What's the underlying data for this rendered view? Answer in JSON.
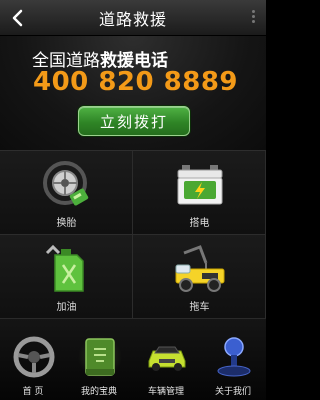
{
  "header": {
    "title": "道路救援",
    "back_icon": "back-arrow-icon",
    "menu_icon": "more-vertical-icon"
  },
  "hotline": {
    "label_prefix": "全国道路",
    "label_bold": "救援电话",
    "number": "400 820 8889",
    "call_button": "立刻拨打",
    "number_color": "#f39a18",
    "button_color": "#2f8526"
  },
  "services": [
    {
      "label": "换胎",
      "icon": "tire-icon"
    },
    {
      "label": "搭电",
      "icon": "battery-icon"
    },
    {
      "label": "加油",
      "icon": "fuel-can-icon"
    },
    {
      "label": "拖车",
      "icon": "tow-truck-icon"
    }
  ],
  "tabs": [
    {
      "label": "首 页",
      "icon": "steering-wheel-icon"
    },
    {
      "label": "我的宝典",
      "icon": "book-icon"
    },
    {
      "label": "车辆管理",
      "icon": "car-icon"
    },
    {
      "label": "关于我们",
      "icon": "gear-shift-icon"
    }
  ]
}
